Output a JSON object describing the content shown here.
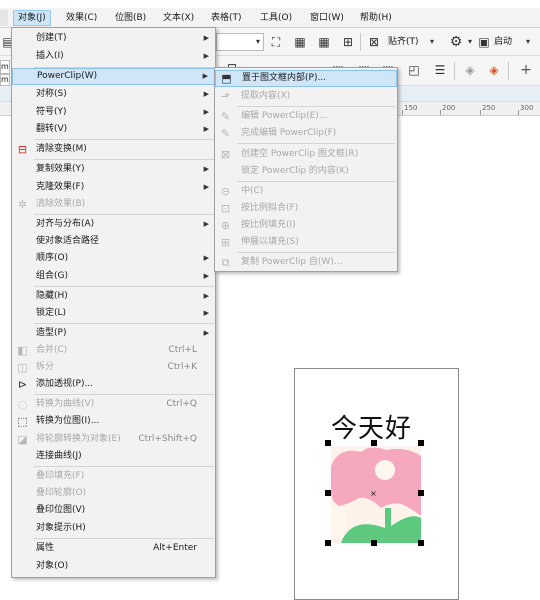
{
  "menubar": {
    "items": [
      {
        "label": "对象(J)",
        "active": true
      },
      {
        "label": "效果(C)"
      },
      {
        "label": "位图(B)"
      },
      {
        "label": "文本(X)"
      },
      {
        "label": "表格(T)"
      },
      {
        "label": "工具(O)"
      },
      {
        "label": "窗口(W)"
      },
      {
        "label": "帮助(H)"
      }
    ]
  },
  "toolbar": {
    "snap_label": "贴齐(T)",
    "launch_label": "启动",
    "left_edge_1": "mi",
    "left_edge_2": "mi"
  },
  "ruler": {
    "labels": [
      "150",
      "200",
      "250",
      "300"
    ]
  },
  "document": {
    "text": "今天好"
  },
  "main_menu": {
    "items": [
      {
        "label": "创建(T)",
        "arrow": true
      },
      {
        "label": "插入(I)",
        "arrow": true
      },
      {
        "label": "PowerClip(W)",
        "arrow": true,
        "highlight": true
      },
      {
        "label": "对称(S)",
        "arrow": true
      },
      {
        "label": "符号(Y)",
        "arrow": true
      },
      {
        "label": "翻转(V)",
        "arrow": true
      },
      {
        "label": "清除变换(M)",
        "icon": "clear-transform-icon"
      },
      {
        "label": "复制效果(Y)",
        "arrow": true
      },
      {
        "label": "克隆效果(F)",
        "arrow": true
      },
      {
        "label": "清除效果(B)",
        "disabled": true,
        "icon": "clear-effect-icon"
      },
      {
        "label": "对齐与分布(A)",
        "arrow": true
      },
      {
        "label": "使对象适合路径"
      },
      {
        "label": "顺序(O)",
        "arrow": true
      },
      {
        "label": "组合(G)",
        "arrow": true
      },
      {
        "label": "隐藏(H)",
        "arrow": true
      },
      {
        "label": "锁定(L)",
        "arrow": true
      },
      {
        "label": "造型(P)",
        "arrow": true
      },
      {
        "label": "合并(C)",
        "shortcut": "Ctrl+L",
        "disabled": true,
        "icon": "combine-icon"
      },
      {
        "label": "拆分",
        "shortcut": "Ctrl+K",
        "disabled": true,
        "icon": "break-apart-icon"
      },
      {
        "label": "添加透视(P)...",
        "icon": "perspective-icon"
      },
      {
        "label": "转换为曲线(V)",
        "shortcut": "Ctrl+Q",
        "disabled": true,
        "icon": "convert-curves-icon"
      },
      {
        "label": "转换为位图(I)...",
        "icon": "convert-bitmap-icon"
      },
      {
        "label": "将轮廓转换为对象(E)",
        "shortcut": "Ctrl+Shift+Q",
        "disabled": true,
        "icon": "outline-object-icon"
      },
      {
        "label": "连接曲线(J)"
      },
      {
        "label": "叠印填充(F)",
        "disabled": true
      },
      {
        "label": "叠印轮廓(O)",
        "disabled": true
      },
      {
        "label": "叠印位图(V)"
      },
      {
        "label": "对象提示(H)"
      },
      {
        "label": "属性",
        "shortcut": "Alt+Enter"
      },
      {
        "label": "对象(O)"
      }
    ]
  },
  "sub_menu": {
    "items": [
      {
        "label": "置于图文框内部(P)...",
        "highlight": true,
        "icon": "place-in-frame-icon"
      },
      {
        "label": "提取内容(X)",
        "disabled": true,
        "icon": "extract-content-icon"
      },
      {
        "label": "编辑 PowerClip(E)...",
        "disabled": true,
        "icon": "edit-pencil-icon"
      },
      {
        "label": "完成编辑 PowerClip(F)",
        "disabled": true,
        "icon": "finish-edit-icon"
      },
      {
        "label": "创建空 PowerClip 图文框(R)",
        "disabled": true,
        "icon": "empty-frame-icon"
      },
      {
        "label": "锁定 PowerClip 的内容(K)",
        "disabled": true
      },
      {
        "label": "中(C)",
        "disabled": true,
        "icon": "center-icon"
      },
      {
        "label": "按比例拟合(F)",
        "disabled": true,
        "icon": "fit-proportional-icon"
      },
      {
        "label": "按比例填充(I)",
        "disabled": true,
        "icon": "fill-proportional-icon"
      },
      {
        "label": "伸展以填充(S)",
        "disabled": true,
        "icon": "stretch-fill-icon"
      },
      {
        "label": "复制 PowerClip 自(W)...",
        "disabled": true,
        "icon": "copy-from-icon"
      }
    ]
  },
  "colors": {
    "menu_highlight": "#cfe6f8",
    "flower_pink": "#f6a8bf",
    "leaf_green": "#5cc97e",
    "flower_center": "#fff6ee"
  }
}
